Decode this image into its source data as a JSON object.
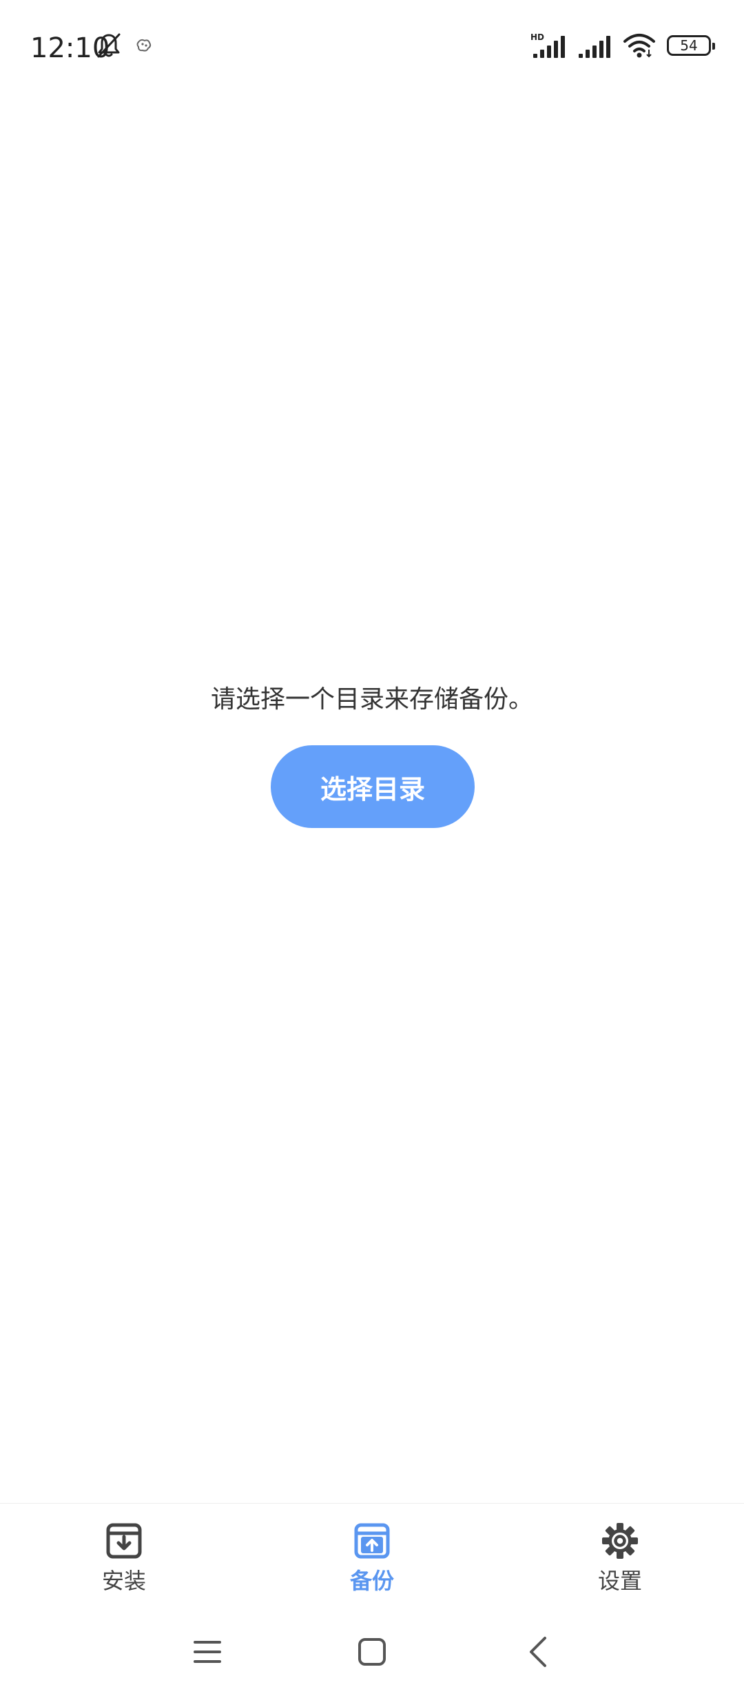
{
  "status_bar": {
    "time": "12:10",
    "network_badge": "HD",
    "battery_level": "54",
    "icons": [
      "bell-muted-icon",
      "notification-icon",
      "signal-hd-icon",
      "signal-icon",
      "wifi-icon",
      "battery-icon"
    ]
  },
  "main": {
    "message": "请选择一个目录来存储备份。",
    "choose_button_label": "选择目录",
    "accent_color": "#64a0fa"
  },
  "bottom_nav": {
    "items": [
      {
        "label": "安装",
        "icon": "install-box-icon",
        "active": false
      },
      {
        "label": "备份",
        "icon": "backup-box-icon",
        "active": true
      },
      {
        "label": "设置",
        "icon": "gear-icon",
        "active": false
      }
    ],
    "active_color": "#5a96f0",
    "inactive_color": "#444444"
  },
  "system_nav": {
    "icons": [
      "menu-icon",
      "home-icon",
      "back-icon"
    ]
  }
}
